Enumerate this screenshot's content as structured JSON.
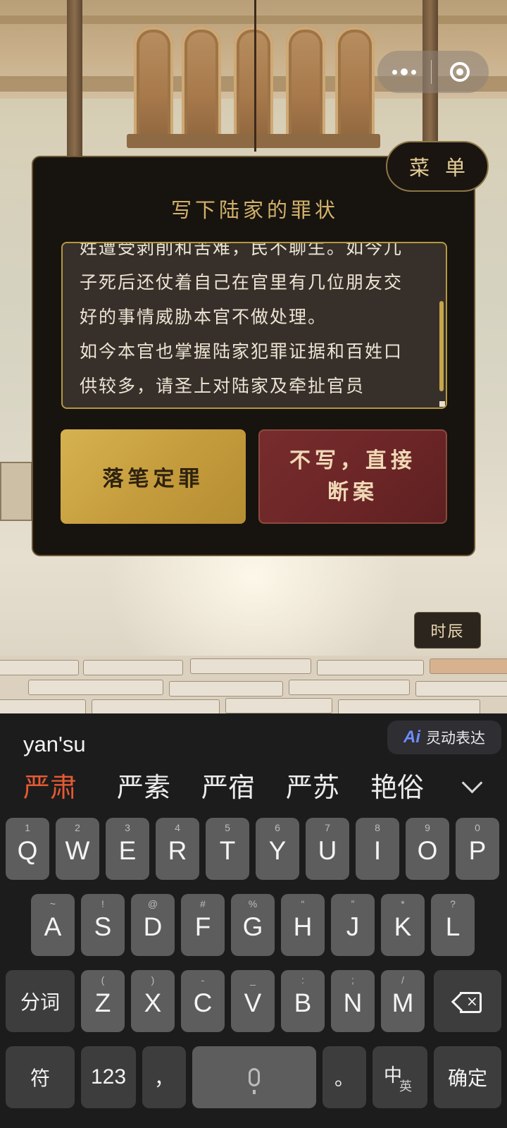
{
  "scene": {
    "dialog_title": "写下陆家的罪状",
    "menu_label": "菜单",
    "time_label": "时辰",
    "crime_text": [
      "姓遭受剥削和苦难，民不聊生。如今儿",
      "子死后还仗着自己在官里有几位朋友交",
      "好的事情威胁本官不做处理。",
      "如今本官也掌握陆家犯罪证据和百姓口",
      "供较多，请圣上对陆家及牵扯官员"
    ],
    "commit_label": "落笔定罪",
    "skip_label": "不写，直接断案"
  },
  "capsule": {
    "more_icon": "more-dots-icon",
    "close_icon": "target-close-icon"
  },
  "keyboard": {
    "pinyin": "yan'su",
    "ai_label": "灵动表达",
    "ai_badge": "Ai",
    "candidates": [
      "严肃",
      "严素",
      "严宿",
      "严苏",
      "艳俗"
    ],
    "row1": [
      {
        "sub": "1",
        "main": "Q"
      },
      {
        "sub": "2",
        "main": "W"
      },
      {
        "sub": "3",
        "main": "E"
      },
      {
        "sub": "4",
        "main": "R"
      },
      {
        "sub": "5",
        "main": "T"
      },
      {
        "sub": "6",
        "main": "Y"
      },
      {
        "sub": "7",
        "main": "U"
      },
      {
        "sub": "8",
        "main": "I"
      },
      {
        "sub": "9",
        "main": "O"
      },
      {
        "sub": "0",
        "main": "P"
      }
    ],
    "row2": [
      {
        "sub": "~",
        "main": "A"
      },
      {
        "sub": "!",
        "main": "S"
      },
      {
        "sub": "@",
        "main": "D"
      },
      {
        "sub": "#",
        "main": "F"
      },
      {
        "sub": "%",
        "main": "G"
      },
      {
        "sub": "“",
        "main": "H"
      },
      {
        "sub": "”",
        "main": "J"
      },
      {
        "sub": "*",
        "main": "K"
      },
      {
        "sub": "?",
        "main": "L"
      }
    ],
    "row3": [
      {
        "sub": "(",
        "main": "Z"
      },
      {
        "sub": ")",
        "main": "X"
      },
      {
        "sub": "-",
        "main": "C"
      },
      {
        "sub": "_",
        "main": "V"
      },
      {
        "sub": ":",
        "main": "B"
      },
      {
        "sub": ";",
        "main": "N"
      },
      {
        "sub": "/",
        "main": "M"
      }
    ],
    "segment_label": "分词",
    "symbol_label": "符",
    "num_label": "123",
    "comma_label": "，",
    "period_label": "。",
    "lang_main": "中",
    "lang_sub": "英",
    "confirm_label": "确定"
  }
}
